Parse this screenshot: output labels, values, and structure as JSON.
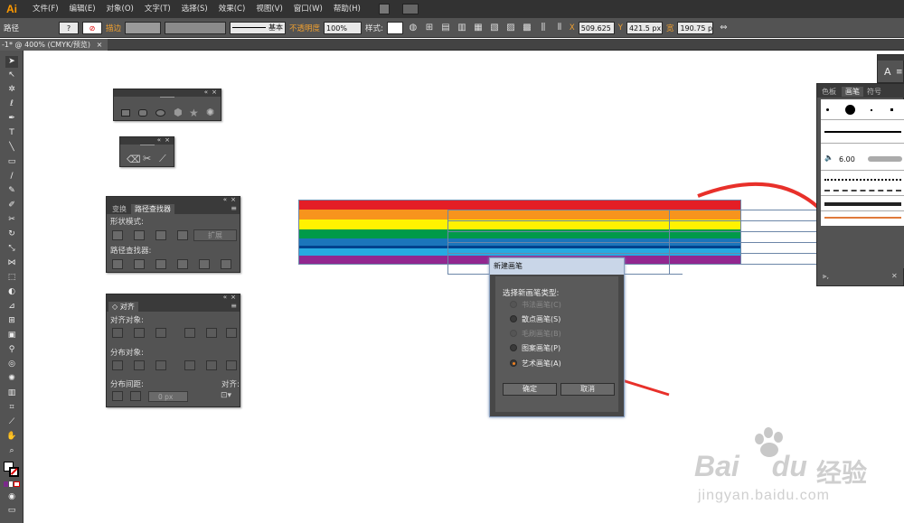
{
  "app": {
    "logo": "Ai"
  },
  "menu": [
    "文件(F)",
    "编辑(E)",
    "对象(O)",
    "文字(T)",
    "选择(S)",
    "效果(C)",
    "视图(V)",
    "窗口(W)",
    "帮助(H)"
  ],
  "control_bar": {
    "selection_label": "路径",
    "stroke_label": "描边",
    "stroke_style": "基本",
    "opacity_label": "不透明度",
    "opacity_value": "100%",
    "style_label": "样式:",
    "x_label": "X",
    "x_value": "509.625",
    "y_label": "Y",
    "y_value": "421.5 px",
    "w_label": "宽",
    "w_value": "190.75 p"
  },
  "document_tab": {
    "title": "-1* @ 400% (CMYK/预览)",
    "close": "×"
  },
  "shapes_panel": {
    "shapes": [
      "rectangle",
      "rounded-rectangle",
      "ellipse",
      "polygon",
      "star",
      "flare"
    ]
  },
  "erase_panel": {
    "tools": [
      "eraser",
      "scissors",
      "knife"
    ]
  },
  "pathfinder_panel": {
    "tabs": [
      "变换",
      "路径查找器"
    ],
    "shape_modes_label": "形状模式:",
    "expand_button": "扩展",
    "pathfinders_label": "路径查找器:"
  },
  "align_panel": {
    "tab": "对齐",
    "align_objects_label": "对齐对象:",
    "distribute_objects_label": "分布对象:",
    "distribute_spacing_label": "分布间距:",
    "align_to_label": "对齐:",
    "spacing_value": "0 px"
  },
  "artwork": {
    "stripe_colors": [
      "#e41e26",
      "#f7941d",
      "#fff200",
      "#009a49",
      "#1b75bb",
      "#00418d",
      "#92278f"
    ]
  },
  "new_brush_dialog": {
    "title": "新建画笔",
    "prompt": "选择新画笔类型:",
    "options": [
      {
        "label": "书法画笔(C)",
        "enabled": false,
        "selected": false
      },
      {
        "label": "散点画笔(S)",
        "enabled": true,
        "selected": false
      },
      {
        "label": "毛刷画笔(B)",
        "enabled": false,
        "selected": false
      },
      {
        "label": "图案画笔(P)",
        "enabled": true,
        "selected": false
      },
      {
        "label": "艺术画笔(A)",
        "enabled": true,
        "selected": true
      }
    ],
    "ok_button": "确定",
    "cancel_button": "取消"
  },
  "brush_panel": {
    "tabs": [
      "色板",
      "画笔",
      "符号"
    ],
    "brush_size": "6.00"
  },
  "annotation_color": "#e8302a",
  "watermark": {
    "brand_text": "Bai",
    "brand_text2": "du",
    "cn_text": "经验",
    "url": "jingyan.baidu.com"
  }
}
